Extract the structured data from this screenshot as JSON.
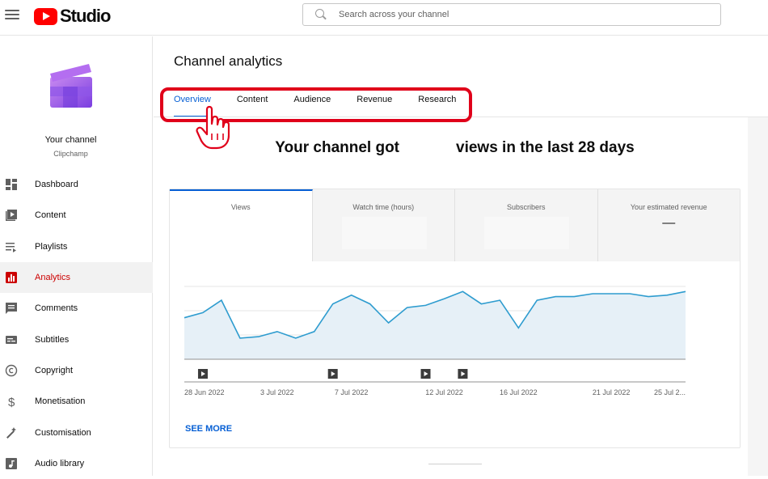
{
  "app": {
    "title": "Studio",
    "brand_color": "#ff0000"
  },
  "search": {
    "placeholder": "Search across your channel",
    "icon": "search-icon"
  },
  "channel": {
    "name": "Your channel",
    "subtitle": "Clipchamp"
  },
  "sidebar": {
    "items": [
      {
        "label": "Dashboard",
        "icon": "dashboard-icon",
        "active": false
      },
      {
        "label": "Content",
        "icon": "content-icon",
        "active": false
      },
      {
        "label": "Playlists",
        "icon": "playlists-icon",
        "active": false
      },
      {
        "label": "Analytics",
        "icon": "analytics-icon",
        "active": true
      },
      {
        "label": "Comments",
        "icon": "comments-icon",
        "active": false
      },
      {
        "label": "Subtitles",
        "icon": "subtitles-icon",
        "active": false
      },
      {
        "label": "Copyright",
        "icon": "copyright-icon",
        "active": false
      },
      {
        "label": "Monetisation",
        "icon": "monetisation-icon",
        "active": false
      },
      {
        "label": "Customisation",
        "icon": "customisation-icon",
        "active": false
      },
      {
        "label": "Audio library",
        "icon": "audio-library-icon",
        "active": false
      }
    ],
    "active_color": "#cc0000"
  },
  "main": {
    "title": "Channel analytics",
    "tabs": [
      {
        "label": "Overview",
        "active": true
      },
      {
        "label": "Content",
        "active": false
      },
      {
        "label": "Audience",
        "active": false
      },
      {
        "label": "Revenue",
        "active": false
      },
      {
        "label": "Research",
        "active": false
      }
    ],
    "headline_prefix": "Your channel got",
    "headline_suffix": "views in the last 28 days",
    "metrics": [
      {
        "label": "Views",
        "value": "",
        "active": true
      },
      {
        "label": "Watch time (hours)",
        "value": "",
        "active": false
      },
      {
        "label": "Subscribers",
        "value": "",
        "active": false
      },
      {
        "label": "Your estimated revenue",
        "value": "—",
        "active": false
      }
    ],
    "see_more": "SEE MORE",
    "accent_color": "#065fd4",
    "highlight_color": "#e0001a"
  },
  "chart_data": {
    "type": "area",
    "x": [
      "28 Jun 2022",
      "29 Jun 2022",
      "30 Jun 2022",
      "1 Jul 2022",
      "2 Jul 2022",
      "3 Jul 2022",
      "4 Jul 2022",
      "5 Jul 2022",
      "6 Jul 2022",
      "7 Jul 2022",
      "8 Jul 2022",
      "9 Jul 2022",
      "10 Jul 2022",
      "11 Jul 2022",
      "12 Jul 2022",
      "13 Jul 2022",
      "14 Jul 2022",
      "15 Jul 2022",
      "16 Jul 2022",
      "17 Jul 2022",
      "18 Jul 2022",
      "19 Jul 2022",
      "20 Jul 2022",
      "21 Jul 2022",
      "22 Jul 2022",
      "23 Jul 2022",
      "24 Jul 2022",
      "25 Jul 2022"
    ],
    "series": [
      {
        "values": [
          0.57,
          0.64,
          0.81,
          0.29,
          0.31,
          0.38,
          0.29,
          0.38,
          0.76,
          0.88,
          0.76,
          0.5,
          0.71,
          0.74,
          0.83,
          0.93,
          0.76,
          0.81,
          0.43,
          0.81,
          0.86,
          0.86,
          0.9,
          0.9,
          0.9,
          0.86,
          0.88,
          0.93
        ]
      }
    ],
    "xticks": [
      "28 Jun 2022",
      "3 Jul 2022",
      "7 Jul 2022",
      "12 Jul 2022",
      "16 Jul 2022",
      "21 Jul 2022",
      "25 Jul 2..."
    ],
    "xtick_indices": [
      0,
      5,
      9,
      14,
      18,
      23,
      27
    ],
    "video_marker_indices": [
      1,
      8,
      13,
      15
    ],
    "ylim": [
      0,
      1.0
    ],
    "grid": true,
    "line_color": "#2e9ccf",
    "fill_color": "#e6f0f7"
  }
}
